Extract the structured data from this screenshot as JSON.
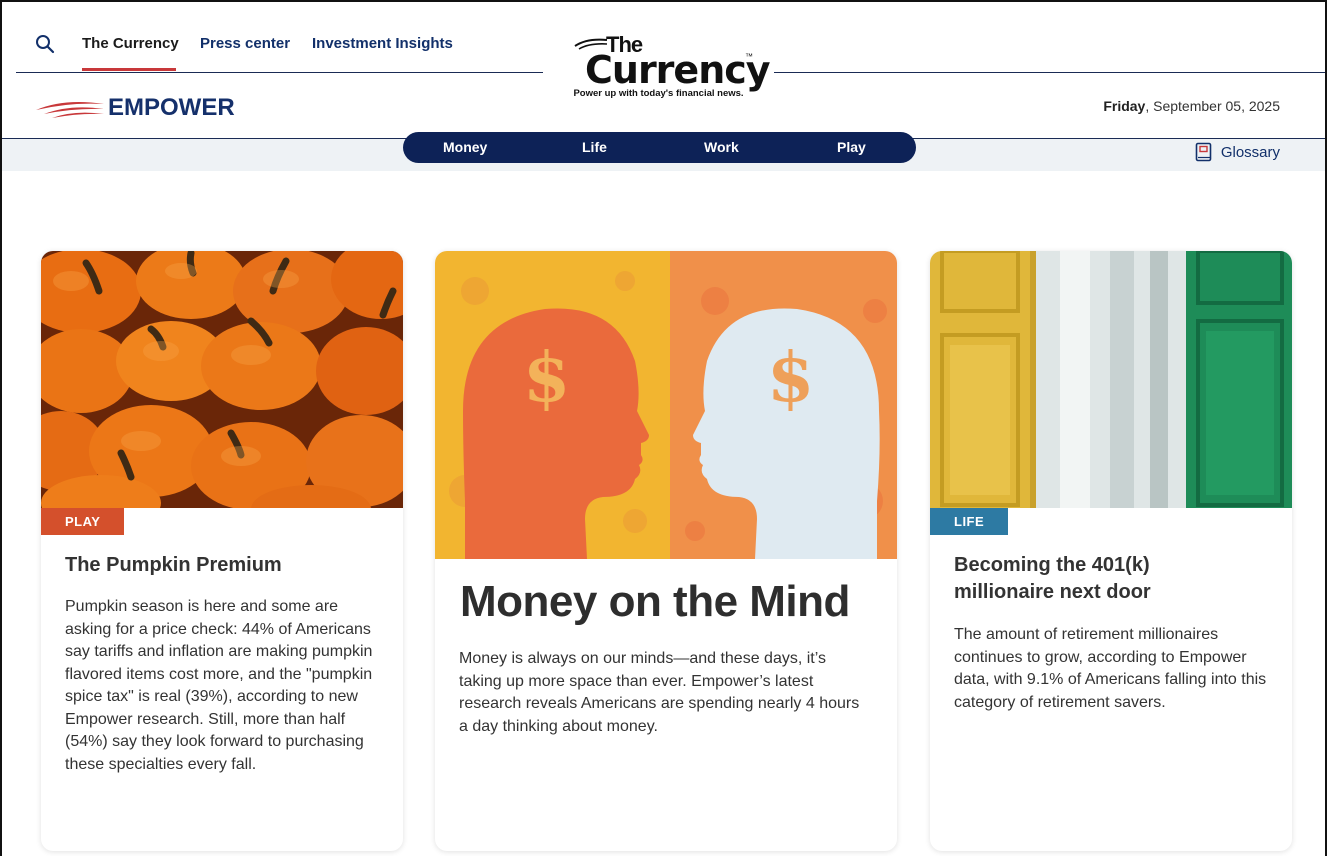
{
  "topnav": {
    "links": [
      {
        "label": "The Currency",
        "active": true
      },
      {
        "label": "Press center",
        "active": false
      },
      {
        "label": "Investment Insights",
        "active": false
      }
    ]
  },
  "masthead": {
    "the": "The",
    "currency": "Currency",
    "tm": "™",
    "tagline": "Power up with today's financial news."
  },
  "brand": {
    "name": "EMPOWER",
    "color": "#15306b",
    "accent": "#c8383a"
  },
  "date": {
    "weekday": "Friday",
    "rest": ", September 05, 2025"
  },
  "categories": [
    "Money",
    "Life",
    "Work",
    "Play"
  ],
  "glossary": {
    "label": "Glossary",
    "icon": "book-icon"
  },
  "cards": [
    {
      "tag": "PLAY",
      "title": "The Pumpkin Premium",
      "body": "Pumpkin season is here and some are asking for a price check: 44% of Americans say tariffs and inflation are making pumpkin flavored items cost more, and the \"pumpkin spice tax\" is real (39%), according to new Empower research. Still, more than half (54%) say they look forward to purchasing these specialties every fall."
    },
    {
      "title": "Money on the Mind",
      "body": "Money is always on our minds—and these days, it’s taking up more space than ever. Empower’s latest research reveals Americans are spending nearly 4 hours a day thinking about money."
    },
    {
      "tag": "LIFE",
      "title": "Becoming the 401(k) millionaire next door",
      "body": "The amount of retirement millionaires continues to grow, according to Empower data, with 9.1% of Americans falling into this category of retirement savers."
    }
  ]
}
